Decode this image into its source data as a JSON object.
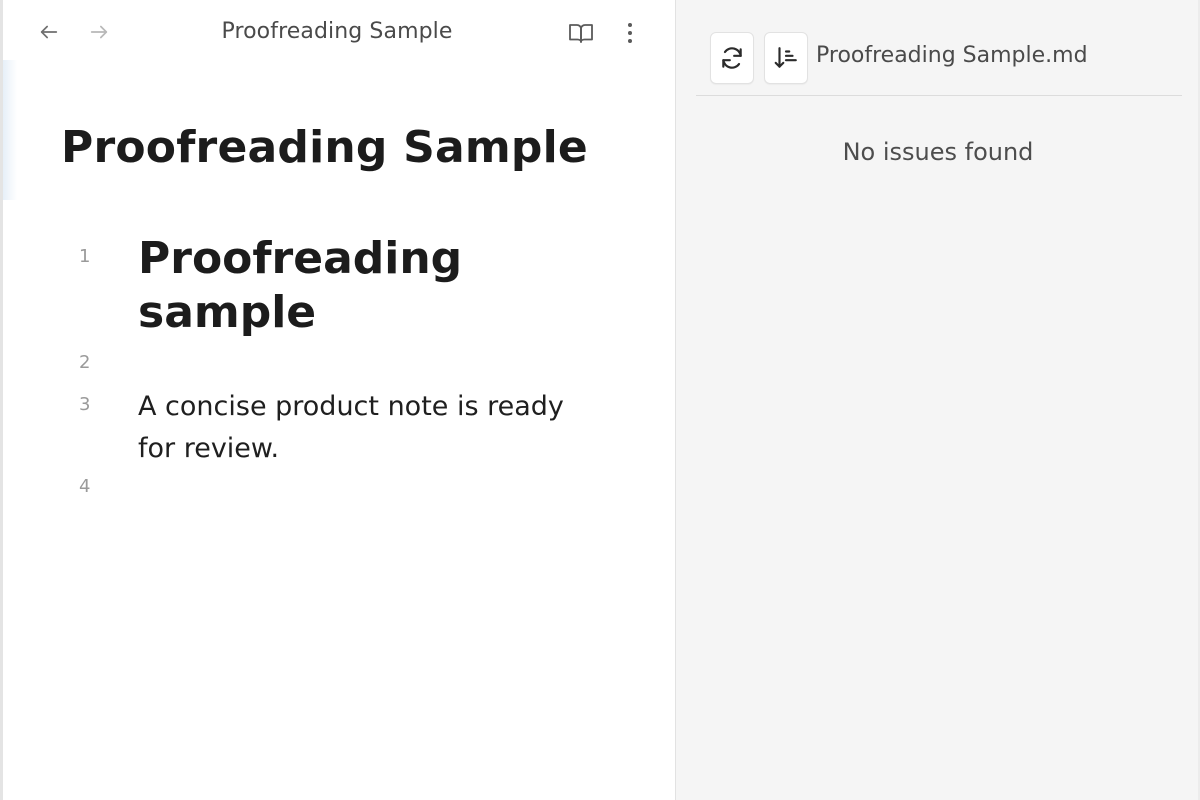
{
  "editor": {
    "tab_title": "Proofreading Sample",
    "document_title": "Proofreading Sample",
    "lines": [
      {
        "number": "1",
        "text": "Proofreading sample",
        "kind": "heading"
      },
      {
        "number": "2",
        "text": "",
        "kind": "blank"
      },
      {
        "number": "3",
        "text": "A concise product note is ready for review.",
        "kind": "paragraph"
      },
      {
        "number": "4",
        "text": "",
        "kind": "blank"
      }
    ],
    "icons": {
      "back": "arrow-left-icon",
      "forward": "arrow-right-icon",
      "reading_view": "book-open-icon",
      "more": "more-vertical-icon"
    }
  },
  "side_panel": {
    "file_name": "Proofreading Sample.md",
    "status": "No issues found",
    "icons": {
      "refresh": "refresh-icon",
      "sort": "sort-icon"
    }
  },
  "colors": {
    "editor_background": "#ffffff",
    "panel_background": "#f5f5f5",
    "text_primary": "#1c1c1c",
    "text_muted": "#4a4a4a",
    "line_number": "#9a9a9a"
  }
}
